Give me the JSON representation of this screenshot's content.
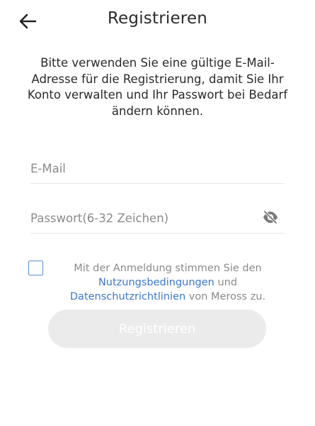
{
  "header": {
    "title": "Registrieren",
    "back_icon": "arrow-left-icon"
  },
  "description": "Bitte verwenden Sie eine gültige E-Mail-Adresse für die Registrierung, damit Sie Ihr Konto verwalten und Ihr Passwort bei Bedarf ändern können.",
  "form": {
    "email": {
      "value": "",
      "placeholder": "E-Mail"
    },
    "password": {
      "value": "",
      "placeholder": "Passwort(6-32 Zeichen)",
      "visibility_icon": "eye-off-icon"
    }
  },
  "terms": {
    "checked": false,
    "prefix": "Mit der Anmeldung stimmen Sie den",
    "terms_link": "Nutzungsbedingungen",
    "conjunction": "und",
    "privacy_link": "Datenschutzrichtlinien",
    "suffix": "von Meross zu."
  },
  "register_button": "Registrieren",
  "colors": {
    "link": "#3a78c9",
    "checkbox_border": "#5b8dd6",
    "button_disabled_bg": "#ebebeb",
    "placeholder": "#8b8b8b"
  }
}
